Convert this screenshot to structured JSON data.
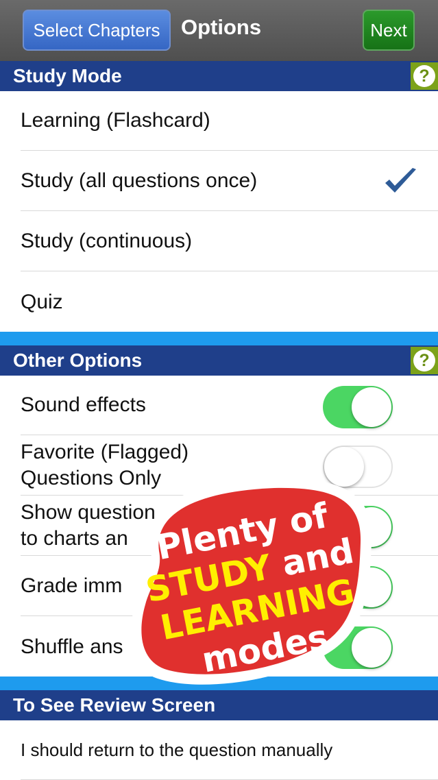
{
  "header": {
    "select_chapters_label": "Select Chapters",
    "title": "Options",
    "next_label": "Next"
  },
  "study_mode": {
    "title": "Study Mode",
    "help": "?",
    "items": [
      {
        "label": "Learning (Flashcard)",
        "selected": false
      },
      {
        "label": "Study (all questions once)",
        "selected": true
      },
      {
        "label": "Study (continuous)",
        "selected": false
      },
      {
        "label": "Quiz",
        "selected": false
      }
    ]
  },
  "other_options": {
    "title": "Other Options",
    "help": "?",
    "items": [
      {
        "label_lines": [
          "Sound effects"
        ],
        "toggle": "on"
      },
      {
        "label_lines": [
          "Favorite (Flagged)",
          "Questions Only"
        ],
        "toggle": "off"
      },
      {
        "label_lines": [
          "Show question",
          "to charts an"
        ],
        "toggle": "on"
      },
      {
        "label_lines": [
          "Grade imm"
        ],
        "toggle": "on"
      },
      {
        "label_lines": [
          "Shuffle ans"
        ],
        "toggle": "on"
      }
    ]
  },
  "review": {
    "title": "To See Review Screen",
    "item": "I should return to the question manually"
  },
  "promo": {
    "line1": "Plenty of",
    "line2a": "STUDY",
    "line2b": "and",
    "line3": "LEARNING",
    "line4": "modes"
  },
  "colors": {
    "section_header": "#1f3f8a",
    "separator": "#1e9bee",
    "toggle_on": "#4bd663",
    "checkmark": "#2e5b97",
    "promo_red": "#e0302e",
    "promo_yellow": "#ffef00"
  },
  "icons": {
    "help": "help-icon",
    "check": "checkmark-icon"
  }
}
